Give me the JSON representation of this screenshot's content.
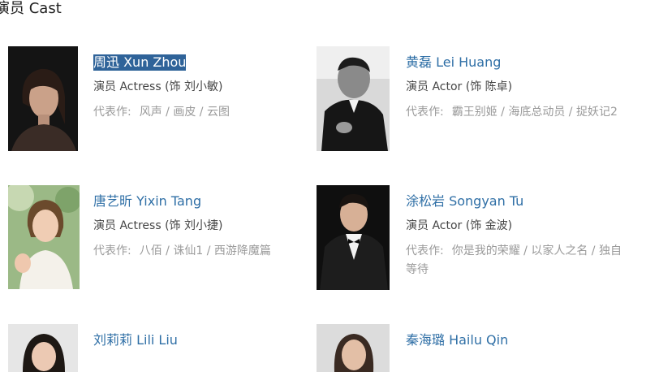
{
  "section": {
    "title": "演员 Cast"
  },
  "works_label": "代表作:",
  "cast": [
    {
      "name": "周迅 Xun Zhou",
      "role": "演员 Actress (饰 刘小敏)",
      "works": "风声 / 画皮 / 云图",
      "selected": true
    },
    {
      "name": "黄磊 Lei Huang",
      "role": "演员 Actor (饰 陈卓)",
      "works": "霸王别姬 / 海底总动员 / 捉妖记2"
    },
    {
      "name": "唐艺昕 Yixin Tang",
      "role": "演员 Actress (饰 刘小捷)",
      "works": "八佰 / 诛仙1 / 西游降魔篇"
    },
    {
      "name": "涂松岩 Songyan Tu",
      "role": "演员 Actor (饰 金波)",
      "works": "你是我的荣耀 / 以家人之名 / 独自等待"
    },
    {
      "name": "刘莉莉 Lili Liu"
    },
    {
      "name": "秦海璐 Hailu Qin"
    }
  ],
  "colors": {
    "link": "#2f6fa6",
    "selection": "#2f6399",
    "muted": "#9a9a9a"
  }
}
